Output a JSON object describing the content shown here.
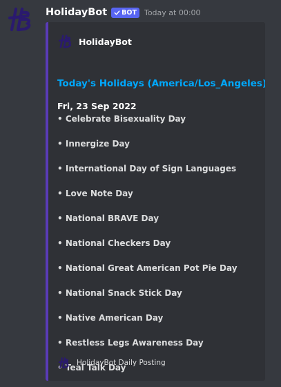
{
  "message": {
    "author": "HolidayBot",
    "bot_tag": "BOT",
    "bot_check_icon": "checkmark-icon",
    "timestamp": "Today at 00:00",
    "avatar_icon": "holidaybot-logo-icon"
  },
  "embed": {
    "accent_color": "#5a3bb7",
    "author_name": "HolidayBot",
    "title": "Today's Holidays (America/Los_Angeles):",
    "date": "Fri, 23 Sep 2022",
    "holidays": [
      "• Celebrate Bisexuality Day",
      "• Innergize Day",
      "• International Day of Sign Languages",
      "• Love Note Day",
      "• National BRAVE Day",
      "• National Checkers Day",
      "• National Great American Pot Pie Day",
      "• National Snack Stick Day",
      "• Native American Day",
      "• Restless Legs Awareness Day",
      "• Teal Talk Day"
    ],
    "footer": "HolidayBot Daily Posting"
  },
  "colors": {
    "background": "#36393f",
    "embed_background": "#2f3136",
    "title_link": "#00a8fc",
    "bot_tag": "#5865f2"
  }
}
